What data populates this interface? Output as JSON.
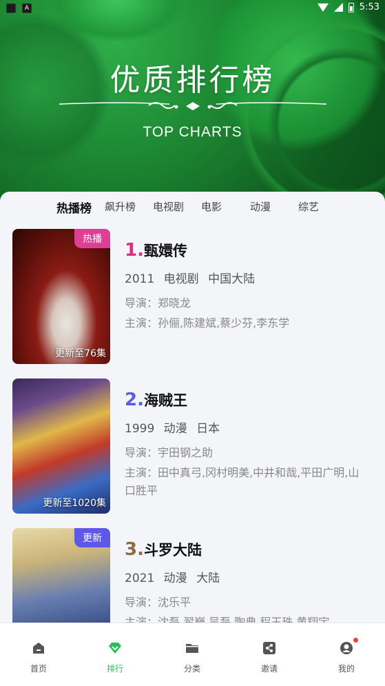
{
  "status_bar": {
    "time": "5:53",
    "app_badge": "A"
  },
  "banner": {
    "title": "优质排行榜",
    "subtitle": "TOP CHARTS"
  },
  "tabs": [
    {
      "label": "热播榜",
      "active": true
    },
    {
      "label": "飙升榜",
      "active": false
    },
    {
      "label": "电视剧",
      "active": false
    },
    {
      "label": "电影",
      "active": false
    },
    {
      "label": "动漫",
      "active": false
    },
    {
      "label": "综艺",
      "active": false
    }
  ],
  "items": [
    {
      "rank": "1.",
      "rank_color": "#d6337f",
      "title": "甄嬛传",
      "year": "2011",
      "genre": "电视剧",
      "region": "中国大陆",
      "director": "导演：郑晓龙",
      "cast": "主演：孙俪,陈建斌,蔡少芬,李东学",
      "badge": "热播",
      "badge_color": "#de3f94",
      "episodes": "更新至76集"
    },
    {
      "rank": "2.",
      "rank_color": "#5b5ce6",
      "title": "海贼王",
      "year": "1999",
      "genre": "动漫",
      "region": "日本",
      "director": "导演：宇田钢之助",
      "cast": "主演：田中真弓,冈村明美,中井和哉,平田广明,山口胜平",
      "badge": "",
      "badge_color": "",
      "episodes": "更新至1020集"
    },
    {
      "rank": "3.",
      "rank_color": "#8a6a4a",
      "title": "斗罗大陆",
      "year": "2021",
      "genre": "动漫",
      "region": "大陆",
      "director": "导演：沈乐平",
      "cast": "主演：沈磊,翟巍,吴磊,陶典,程玉珠,黄翔宇",
      "badge": "更新",
      "badge_color": "#5e58e8",
      "episodes": ""
    }
  ],
  "nav": [
    {
      "label": "首页",
      "icon": "home-icon",
      "active": false
    },
    {
      "label": "排行",
      "icon": "ranking-icon",
      "active": true
    },
    {
      "label": "分类",
      "icon": "folder-icon",
      "active": false
    },
    {
      "label": "邀请",
      "icon": "share-icon",
      "active": false
    },
    {
      "label": "我的",
      "icon": "profile-icon",
      "active": false,
      "notification": true
    }
  ],
  "colors": {
    "accent": "#26c059",
    "banner_green": "#1e8a34"
  }
}
